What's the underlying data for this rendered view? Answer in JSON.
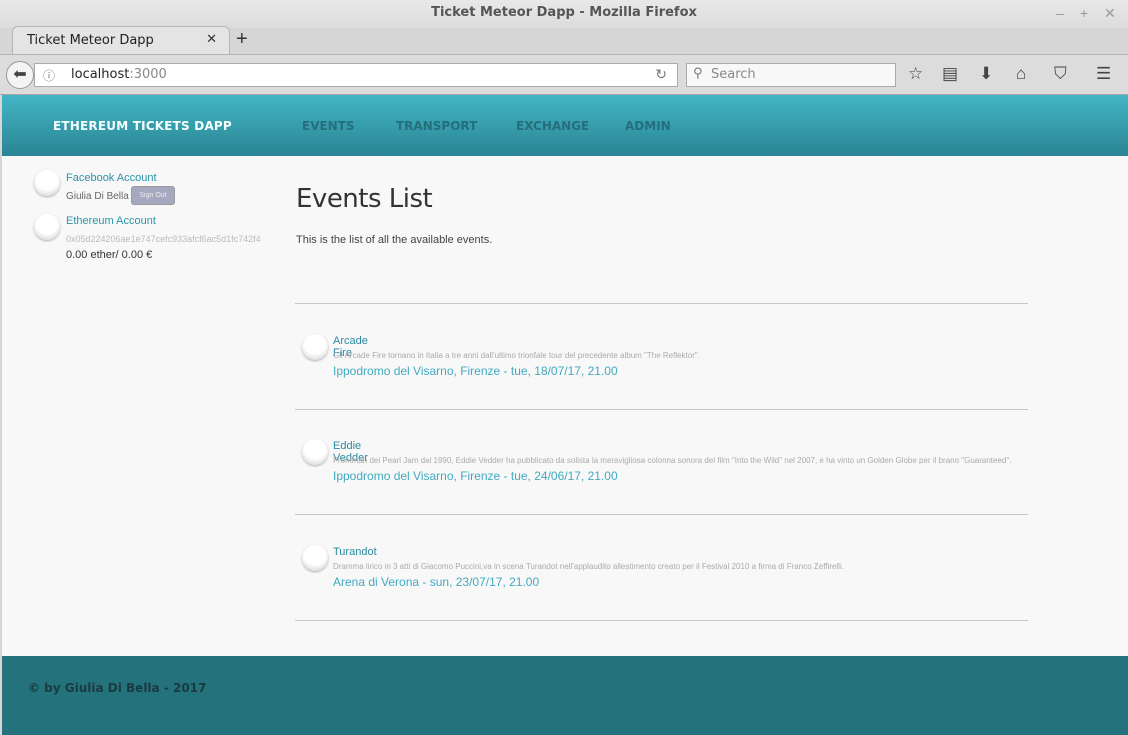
{
  "window": {
    "title": "Ticket Meteor Dapp - Mozilla Firefox"
  },
  "tab": {
    "label": "Ticket Meteor Dapp"
  },
  "urlbar": {
    "host": "localhost",
    "port": ":3000"
  },
  "search": {
    "placeholder": "Search"
  },
  "header": {
    "brand": "ETHEREUM TICKETS DAPP",
    "nav": [
      "EVENTS",
      "TRANSPORT",
      "EXCHANGE",
      "ADMIN"
    ]
  },
  "sidebar": {
    "facebook": {
      "label": "Facebook Account",
      "name": "Giulia Di Bella",
      "signout": "Sign Out"
    },
    "ethereum": {
      "label": "Ethereum Account",
      "address": "0x05d224206ae1e747cefc933afcf6ac5d1fc742f4",
      "balance": "0.00 ether/ 0.00 €"
    }
  },
  "main": {
    "title": "Events List",
    "lead": "This is the list of all the available events.",
    "events": [
      {
        "name": "Arcade Fire",
        "description": "Gli Arcade Fire tornano in Italia a tre anni dall'ultimo trionfale tour del precedente album \"The Reflektor\".",
        "location": "Ippodromo del Visarno, Firenze - tue, 18/07/17, 21.00"
      },
      {
        "name": "Eddie Vedder",
        "description": "Frontman dei Pearl Jam dal 1990, Eddie Vedder ha pubblicato da solista la meravigliosa colonna sonora del film \"Into the Wild\" nel 2007, e ha vinto un Golden Globe per il brano \"Guaranteed\".",
        "location": "Ippodromo del Visarno, Firenze - tue, 24/06/17, 21.00"
      },
      {
        "name": "Turandot",
        "description": "Dramma lirico in 3 atti di Giacomo Puccini,va in scena Turandot nell'applaudito allestimento creato per il Festival 2010 a firma di Franco Zeffirelli.",
        "location": "Arena di Verona - sun, 23/07/17, 21.00"
      }
    ]
  },
  "footer": {
    "text": "© by Giulia Di Bella - 2017"
  },
  "colors": {
    "header_top": "#43b5c5",
    "header_bottom": "#2a8593",
    "footer": "#24737c",
    "link": "#2a94aa"
  }
}
